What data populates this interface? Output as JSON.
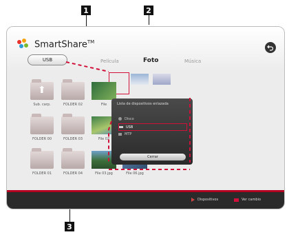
{
  "callouts": [
    "1",
    "2",
    "3"
  ],
  "app": {
    "title": "SmartShare",
    "trademark": "TM"
  },
  "device_button": "USB",
  "tabs": [
    {
      "label": "Película",
      "active": false
    },
    {
      "label": "Foto",
      "active": true
    },
    {
      "label": "Música",
      "active": false
    }
  ],
  "back_icon": "return-arrow-icon",
  "files": [
    {
      "label": "Sub. carp."
    },
    {
      "label": "FOLDER 02"
    },
    {
      "label": "File"
    },
    {
      "label": "FOLDER 00"
    },
    {
      "label": "FOLDER 03"
    },
    {
      "label": "File 02"
    },
    {
      "label": "FOLDER 01"
    },
    {
      "label": "FOLDER 04"
    },
    {
      "label": "File 03.jpg"
    },
    {
      "label": "File 06.jpg"
    }
  ],
  "dialog": {
    "title": "Lista de dispositivos enlazada",
    "items": [
      {
        "label": "Disco",
        "selected": false
      },
      {
        "label": "USB",
        "selected": true
      },
      {
        "label": "MTP",
        "selected": false
      }
    ],
    "close_label": "Cerrar"
  },
  "bottom_bar": {
    "devices_label": "Dispositivos",
    "change_view_label": "Ver cambio"
  },
  "colors": {
    "accent": "#d0103a",
    "callout": "#111111"
  }
}
